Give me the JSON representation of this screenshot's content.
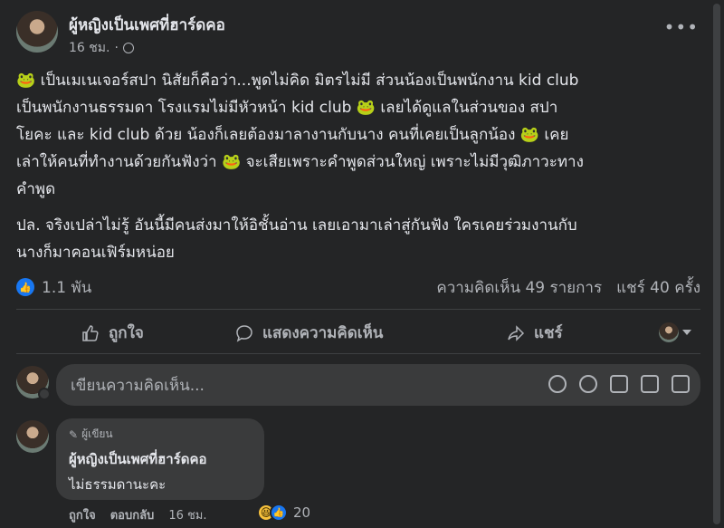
{
  "post": {
    "author": "ผู้หญิงเป็นเพศที่ฮาร์ดคอ",
    "time": "16 ชม.",
    "privacy_icon": "globe-icon",
    "paragraph1": "🐸 เป็นเมเนเจอร์สปา นิสัยก็คือว่า...พูดไม่คิด มิตรไม่มี ส่วนน้องเป็นพนักงาน kid club\nเป็นพนักงานธรรมดา โรงแรมไม่มีหัวหน้า kid club 🐸 เลยได้ดูแลในส่วนของ สปา\nโยคะ  และ kid club ด้วย น้องก็เลยต้องมาลางานกับนาง คนที่เคยเป็นลูกน้อง 🐸 เคย\nเล่าให้คนที่ทำงานด้วยกันฟังว่า 🐸 จะเสียเพราะคำพูดส่วนใหญ่ เพราะไม่มีวุฒิภาวะทาง\nคำพูด",
    "paragraph2": "ปล. จริงเปล่าไม่รู้ อันนี้มีคนส่งมาให้อิชั้นอ่าน เลยเอามาเล่าสู่กันฟัง ใครเคยร่วมงานกับ\nนางก็มาคอนเฟิร์มหน่อย"
  },
  "stats": {
    "likes": "1.1 พัน",
    "comments": "ความคิดเห็น 49 รายการ",
    "shares": "แชร์ 40 ครั้ง"
  },
  "actions": {
    "like": "ถูกใจ",
    "comment": "แสดงความคิดเห็น",
    "share": "แชร์"
  },
  "composer": {
    "placeholder": "เขียนความคิดเห็น..."
  },
  "comment": {
    "badge": "ผู้เขียน",
    "author": "ผู้หญิงเป็นเพศที่ฮาร์ดคอ",
    "text": "ไม่ธรรมดานะคะ",
    "like": "ถูกใจ",
    "reply": "ตอบกลับ",
    "time": "16 ชม.",
    "reaction_count": "20"
  },
  "colors": {
    "background": "#242526",
    "text": "#e4e6eb",
    "secondary": "#b0b3b8",
    "accent": "#1877f2"
  }
}
